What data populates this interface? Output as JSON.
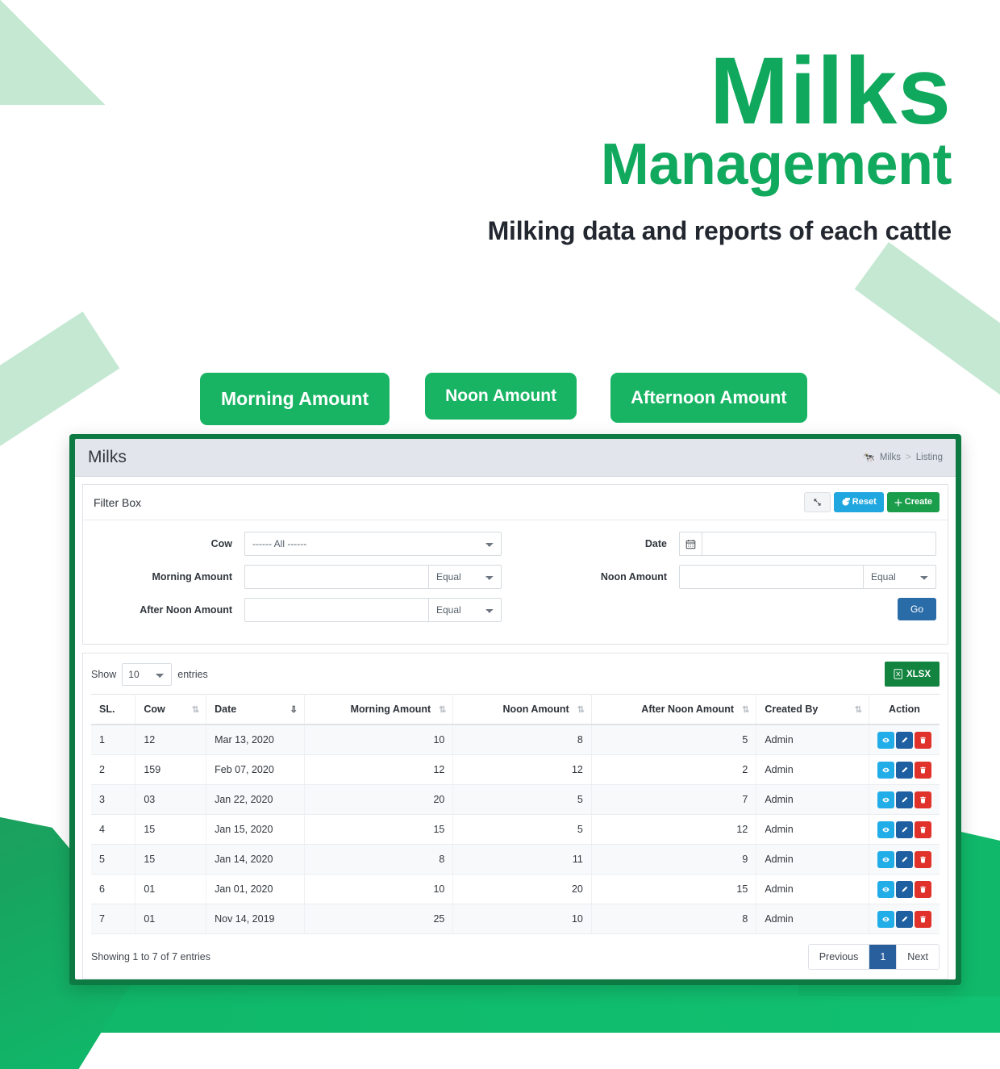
{
  "hero": {
    "title": "Milks",
    "subtitle": "Management",
    "tagline": "Milking data and reports of each cattle"
  },
  "quick_buttons": [
    {
      "label": "Morning Amount"
    },
    {
      "label": "Noon Amount"
    },
    {
      "label": "Afternoon Amount"
    }
  ],
  "card": {
    "title": "Milks",
    "breadcrumb": {
      "icon": "cow-icon",
      "root": "Milks",
      "separator": ">",
      "current": "Listing"
    }
  },
  "filter": {
    "title": "Filter Box",
    "collapse_icon": "collapse-arrows-icon",
    "reset_label": "Reset",
    "reset_icon": "refresh-icon",
    "create_label": "Create",
    "create_icon": "plus-icon",
    "go_label": "Go",
    "fields": {
      "cow": {
        "label": "Cow",
        "value": "------ All ------"
      },
      "date": {
        "label": "Date",
        "value": "",
        "placeholder": "",
        "icon": "calendar-icon"
      },
      "morning": {
        "label": "Morning Amount",
        "value": "",
        "operator": "Equal"
      },
      "noon": {
        "label": "Noon Amount",
        "value": "",
        "operator": "Equal"
      },
      "afternoon": {
        "label": "After Noon Amount",
        "value": "",
        "operator": "Equal"
      }
    }
  },
  "table": {
    "show_label": "Show",
    "entries_label": "entries",
    "page_length": "10",
    "export_label": "XLSX",
    "export_icon": "excel-file-icon",
    "columns": [
      {
        "label": "SL.",
        "sortable": false
      },
      {
        "label": "Cow",
        "sortable": true,
        "sort": "none"
      },
      {
        "label": "Date",
        "sortable": true,
        "sort": "desc"
      },
      {
        "label": "Morning Amount",
        "sortable": true,
        "sort": "none",
        "align": "right"
      },
      {
        "label": "Noon Amount",
        "sortable": true,
        "sort": "none",
        "align": "right"
      },
      {
        "label": "After Noon Amount",
        "sortable": true,
        "sort": "none",
        "align": "right"
      },
      {
        "label": "Created By",
        "sortable": true,
        "sort": "none"
      },
      {
        "label": "Action",
        "sortable": false,
        "align": "center"
      }
    ],
    "rows": [
      {
        "sl": "1",
        "cow": "12",
        "date": "Mar 13, 2020",
        "morning": "10",
        "noon": "8",
        "afternoon": "5",
        "created_by": "Admin"
      },
      {
        "sl": "2",
        "cow": "159",
        "date": "Feb 07, 2020",
        "morning": "12",
        "noon": "12",
        "afternoon": "2",
        "created_by": "Admin"
      },
      {
        "sl": "3",
        "cow": "03",
        "date": "Jan 22, 2020",
        "morning": "20",
        "noon": "5",
        "afternoon": "7",
        "created_by": "Admin"
      },
      {
        "sl": "4",
        "cow": "15",
        "date": "Jan 15, 2020",
        "morning": "15",
        "noon": "5",
        "afternoon": "12",
        "created_by": "Admin"
      },
      {
        "sl": "5",
        "cow": "15",
        "date": "Jan 14, 2020",
        "morning": "8",
        "noon": "11",
        "afternoon": "9",
        "created_by": "Admin"
      },
      {
        "sl": "6",
        "cow": "01",
        "date": "Jan 01, 2020",
        "morning": "10",
        "noon": "20",
        "afternoon": "15",
        "created_by": "Admin"
      },
      {
        "sl": "7",
        "cow": "01",
        "date": "Nov 14, 2019",
        "morning": "25",
        "noon": "10",
        "afternoon": "8",
        "created_by": "Admin"
      }
    ],
    "row_actions": [
      {
        "name": "view-button",
        "icon": "eye-icon"
      },
      {
        "name": "edit-button",
        "icon": "pencil-icon"
      },
      {
        "name": "delete-button",
        "icon": "trash-icon"
      }
    ],
    "info": "Showing 1 to 7 of 7 entries",
    "pagination": {
      "previous": "Previous",
      "pages": [
        "1"
      ],
      "next": "Next",
      "active": "1"
    }
  },
  "colors": {
    "brand_green": "#10a85c",
    "button_green": "#18b463",
    "card_border_green": "#0e7a43",
    "info_blue": "#21a7e0",
    "primary_blue": "#2a6ca8",
    "danger_red": "#e0312a",
    "excel_green": "#13843f"
  }
}
